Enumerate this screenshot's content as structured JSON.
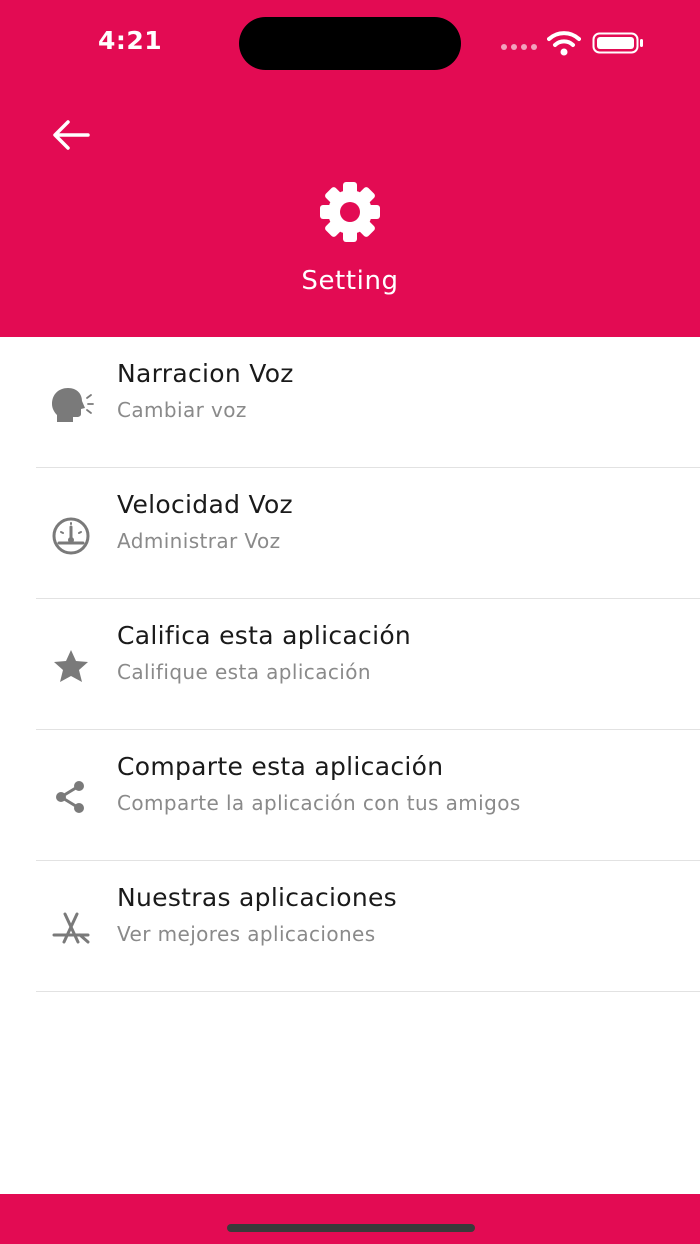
{
  "colors": {
    "accent": "#E30B53",
    "title_text": "#1a1a1a",
    "subtitle_text": "#8a8a8a",
    "icon": "#7a7a7a"
  },
  "status_bar": {
    "time": "4:21"
  },
  "header": {
    "back_icon": "arrow-left-icon",
    "header_icon": "gear-icon",
    "title": "Setting"
  },
  "settings": {
    "items": [
      {
        "icon": "speaking-head-icon",
        "title": "Narracion Voz",
        "subtitle": "Cambiar voz"
      },
      {
        "icon": "speedometer-icon",
        "title": "Velocidad Voz",
        "subtitle": "Administrar Voz"
      },
      {
        "icon": "star-icon",
        "title": "Califica esta aplicación",
        "subtitle": "Califique esta aplicación"
      },
      {
        "icon": "share-icon",
        "title": "Comparte esta aplicación",
        "subtitle": "Comparte la aplicación con tus amigos"
      },
      {
        "icon": "app-store-icon",
        "title": "Nuestras aplicaciones",
        "subtitle": "Ver mejores aplicaciones"
      }
    ]
  }
}
